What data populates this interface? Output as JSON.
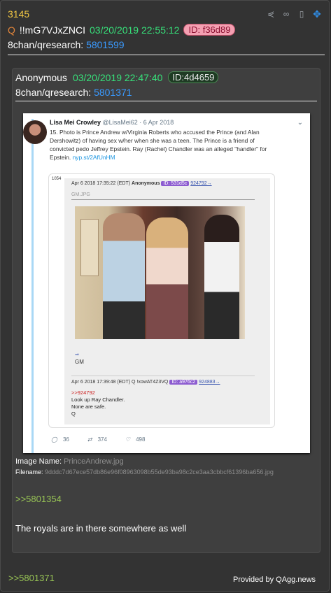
{
  "post": {
    "number": "3145",
    "q_mark": "Q",
    "tripcode": "!!mG7VJxZNCI",
    "date": "03/20/2019 22:55:12",
    "id": "ID: f36d89",
    "board": "8chan/qresearch:",
    "post_link": "5801599",
    "icons": [
      "share-icon",
      "glasses-icon",
      "document-icon",
      "move-icon"
    ]
  },
  "quoted_post": {
    "author": "Anonymous",
    "date": "03/20/2019 22:47:40",
    "id": "ID:4d4659",
    "board": "8chan/qresearch:",
    "post_link": "5801371",
    "image_name_label": "Image Name:",
    "image_name": "PrinceAndrew.jpg",
    "filename_label": "Filename:",
    "filename": "9dddc7d67ece57db86e96f08963098b55de93ba98c2ce3aa3cbbcf61396ba656.jpg",
    "reply_link": ">>5801354",
    "message": "The royals are in there somewhere as well"
  },
  "tweet": {
    "name": "Lisa Mei Crowley",
    "handle": "@LisaMei62 · 6 Apr 2018",
    "text": "15. Photo is Prince Andrew w/Virginia Roberts who accused the Prince (and Alan Dershowitz) of having sex w/her when she was a teen. The Prince is a friend of convicted pedo Jeffrey Epstein. Ray (Rachel) Chandler was an alleged \"handler\" for Epstein.",
    "link": "nyp.st/2AfUnHM",
    "replies": "36",
    "retweets": "374",
    "likes": "498",
    "embedded": {
      "num": "1054",
      "header1_date": "Apr 6 2018 17:35:22 (EDT)",
      "header1_author": "Anonymous",
      "header1_id": "ID: 531d5c",
      "header1_ref": "924792→",
      "file": "GM.JPG",
      "arrow": "⇒",
      "gm": "GM",
      "header2_text": "Apr 6 2018 17:39:48 (EDT) Q !xowAT4Z3VQ",
      "header2_id": "ID: a976c2",
      "header2_ref": "924883→",
      "reply_ref": ">>924792",
      "line1": "Look up Ray Chandler.",
      "line2": "None are safe.",
      "line3": "Q"
    }
  },
  "footer": {
    "link": ">>5801371",
    "provided": "Provided by QAgg.news"
  }
}
